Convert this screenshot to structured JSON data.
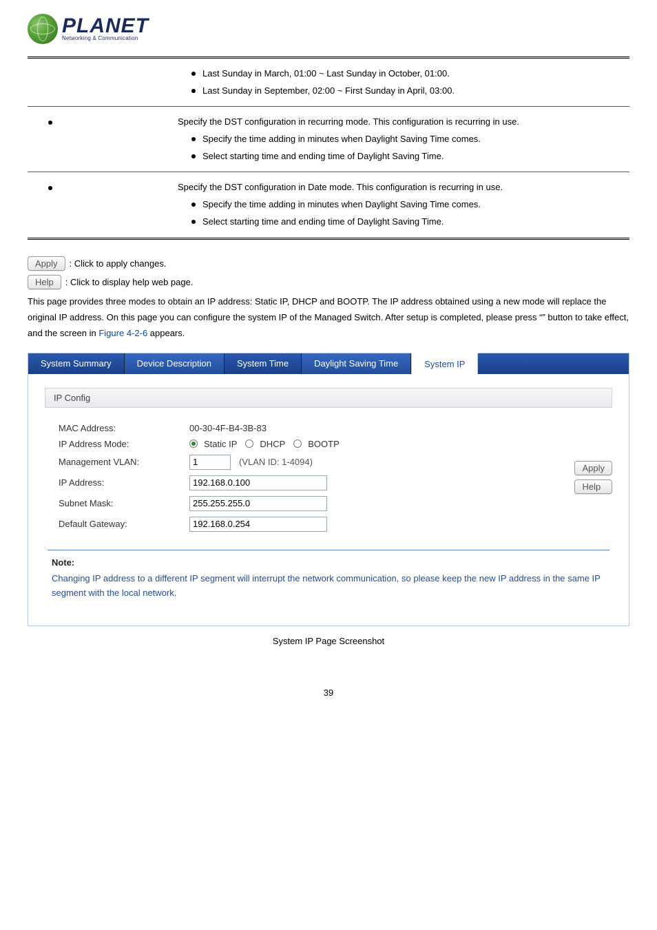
{
  "logo": {
    "main": "PLANET",
    "sub": "Networking & Communication"
  },
  "table": {
    "row1": {
      "b1": "Last Sunday in March, 01:00 ~ Last Sunday in October, 01:00.",
      "b2": "Last Sunday in September, 02:00 ~ First Sunday in April, 03:00."
    },
    "row2": {
      "lead": "Specify the DST configuration in recurring mode. This configuration is recurring in use.",
      "b1": "Specify the time adding in minutes when Daylight Saving Time comes.",
      "b2": "Select starting time and ending time of Daylight Saving Time."
    },
    "row3": {
      "lead": "Specify the DST configuration in Date mode. This configuration is recurring in use.",
      "b1": "Specify the time adding in minutes when Daylight Saving Time comes.",
      "b2": "Select starting time and ending time of Daylight Saving Time."
    }
  },
  "buttons": {
    "apply": "Apply",
    "help": "Help",
    "apply_desc": ": Click to apply changes.",
    "help_desc": ": Click to display help web page."
  },
  "intro": {
    "t1": "This page provides three modes to obtain an IP address: Static IP, DHCP and BOOTP. The IP address obtained using a new mode will replace the original IP address. On this page you can configure the system IP of the Managed Switch. After setup is completed, please press “",
    "t2": "” button to take effect, and the screen in ",
    "figref": "Figure 4-2-6",
    "t3": " appears."
  },
  "tabs": {
    "summary": "System Summary",
    "device": "Device Description",
    "time": "System Time",
    "dst": "Daylight Saving Time",
    "ip": "System IP"
  },
  "cfg": {
    "header": "IP Config",
    "mac_l": "MAC Address:",
    "mac_v": "00-30-4F-B4-3B-83",
    "mode_l": "IP Address Mode:",
    "mode_static": "Static IP",
    "mode_dhcp": "DHCP",
    "mode_bootp": "BOOTP",
    "vlan_l": "Management VLAN:",
    "vlan_v": "1",
    "vlan_hint": "(VLAN ID: 1-4094)",
    "ip_l": "IP Address:",
    "ip_v": "192.168.0.100",
    "mask_l": "Subnet Mask:",
    "mask_v": "255.255.255.0",
    "gw_l": "Default Gateway:",
    "gw_v": "192.168.0.254"
  },
  "note": {
    "title": "Note:",
    "body": "Changing IP address to a different IP segment will interrupt the network communication, so please keep the new IP address in the same IP segment with the local network."
  },
  "caption": "System IP Page Screenshot",
  "pagenum": "39"
}
